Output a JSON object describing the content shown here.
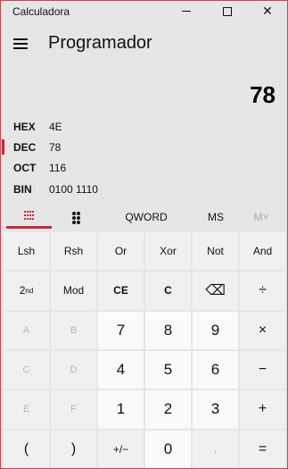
{
  "window": {
    "title": "Calculadora"
  },
  "header": {
    "mode": "Programador"
  },
  "display": {
    "value": "78"
  },
  "radix": [
    {
      "label": "HEX",
      "value": "4E",
      "selected": false
    },
    {
      "label": "DEC",
      "value": "78",
      "selected": true
    },
    {
      "label": "OCT",
      "value": "116",
      "selected": false
    },
    {
      "label": "BIN",
      "value": "0100 1110",
      "selected": false
    }
  ],
  "tools": {
    "word_size": "QWORD",
    "ms": "MS",
    "m_recall": "M˅"
  },
  "keys": {
    "lsh": "Lsh",
    "rsh": "Rsh",
    "or": "Or",
    "xor": "Xor",
    "not": "Not",
    "and": "And",
    "second_base": "2",
    "second_sup": "nd",
    "mod": "Mod",
    "ce": "CE",
    "c": "C",
    "backspace": "⌫",
    "divide": "÷",
    "a": "A",
    "b": "B",
    "seven": "7",
    "eight": "8",
    "nine": "9",
    "multiply": "×",
    "c_hex": "C",
    "d": "D",
    "four": "4",
    "five": "5",
    "six": "6",
    "minus": "−",
    "e": "E",
    "f": "F",
    "one": "1",
    "two": "2",
    "three": "3",
    "plus": "+",
    "lparen": "(",
    "rparen": ")",
    "negate": "+/−",
    "zero": "0",
    "decimal": ",",
    "equals": "="
  },
  "colors": {
    "accent": "#c42b3b",
    "background": "#e6e6e6",
    "key": "#f0f0f0",
    "number_key": "#fafafa"
  }
}
